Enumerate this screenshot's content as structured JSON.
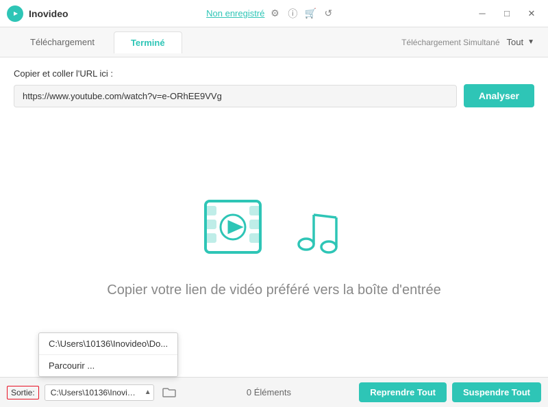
{
  "titleBar": {
    "appName": "Inovideo",
    "nonEnregistre": "Non enregistré"
  },
  "titleIcons": {
    "settings": "⚙",
    "info": "ⓘ",
    "cart": "🛒",
    "refresh": "↺",
    "minimize": "─",
    "maximize": "□",
    "close": "✕"
  },
  "tabs": {
    "telechargement": "Téléchargement",
    "termine": "Terminé",
    "simultane": "Téléchargement Simultané",
    "tout": "Tout"
  },
  "urlSection": {
    "label": "Copier et coller l'URL ici :",
    "placeholder": "https://www.youtube.com/watch?v=e-ORhEE9VVg",
    "analyserBtn": "Analyser"
  },
  "emptyState": {
    "text": "Copier votre lien de vidéo préféré vers la boîte d'entrée"
  },
  "bottomBar": {
    "sortieLabel": "Sortie:",
    "pathValue": "C:\\Users\\10136\\Inovideo\\Do...",
    "pathFull": "C:\\Users\\10136\\Inovideo",
    "elementsLabel": "0 Éléments",
    "reprendreBtn": "Reprendre Tout",
    "suspendreTout": "Suspendre Tout"
  },
  "dropdownMenu": {
    "items": [
      "C:\\Users\\10136\\Inovideo\\Do...",
      "Parcourir ..."
    ]
  }
}
